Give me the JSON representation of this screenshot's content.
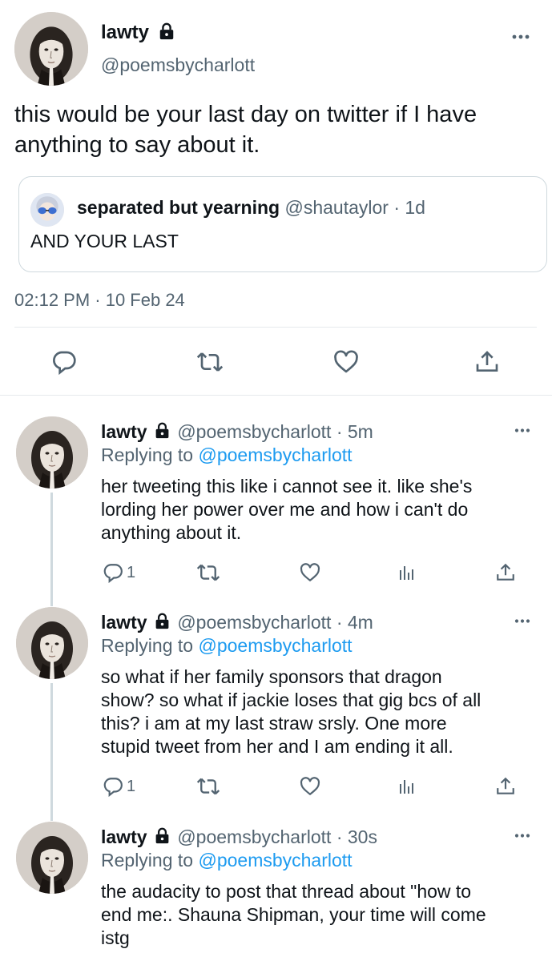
{
  "main_tweet": {
    "display_name": "lawty",
    "handle": "@poemsbycharlott",
    "text_line1": "this would be your last day on twitter if I have",
    "text_line2": "anything to say about it.",
    "quote": {
      "display_name": "separated but yearning",
      "handle": "@shautaylor",
      "time": "· 1d",
      "text": "AND YOUR LAST"
    },
    "timestamp": "02:12 PM · 10 Feb 24",
    "actions": [
      "reply-icon",
      "retweet-icon",
      "like-icon",
      "share-icon"
    ]
  },
  "replies": [
    {
      "display_name": "lawty",
      "handle": "@poemsbycharlott",
      "time": "· 5m",
      "replying_prefix": "Replying to",
      "replying_handle": "@poemsbycharlott",
      "lines": [
        "her tweeting this like i cannot see it. like she's",
        "lording her power over me and how i can't do",
        "anything about it."
      ],
      "reply_count": "1"
    },
    {
      "display_name": "lawty",
      "handle": "@poemsbycharlott",
      "time": "· 4m",
      "replying_prefix": "Replying to",
      "replying_handle": "@poemsbycharlott",
      "lines": [
        "so what if her family sponsors that dragon",
        "show? so what if jackie loses that gig bcs of all",
        "this? i am at my last straw srsly. One more",
        "stupid tweet from her and I am ending it all."
      ],
      "reply_count": "1"
    },
    {
      "display_name": "lawty",
      "handle": "@poemsbycharlott",
      "time": "· 30s",
      "replying_prefix": "Replying to",
      "replying_handle": "@poemsbycharlott",
      "lines": [
        "the audacity to post that thread about \"how to",
        "end me:. Shauna Shipman, your time will come",
        "istg"
      ]
    }
  ],
  "icons": {
    "more": "more-icon",
    "lock": "lock-icon",
    "analytics": "analytics-icon"
  },
  "colors": {
    "text": "#0f1419",
    "secondary": "#536471",
    "link": "#1d9bf0",
    "divider": "#e6e9ec"
  }
}
